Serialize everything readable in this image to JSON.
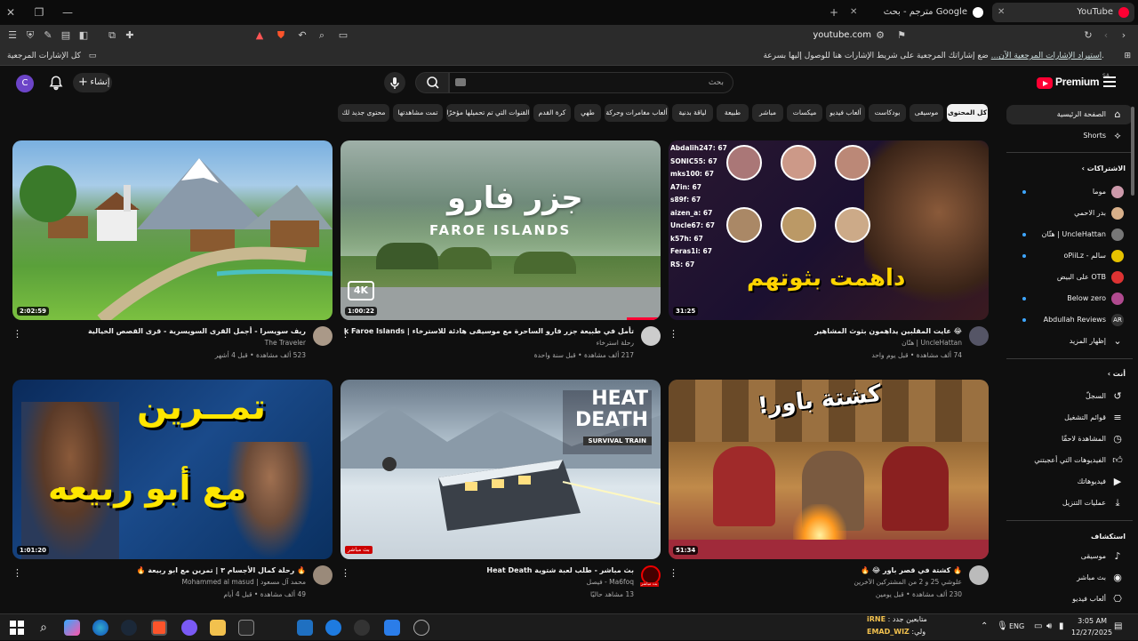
{
  "browser": {
    "tabs": [
      {
        "title": "YouTube",
        "active": true
      },
      {
        "title": "مترجم - بحث Google",
        "active": false
      }
    ],
    "url": "youtube.com",
    "bookmarks_folder": "كل الإشارات المرجعية",
    "bookmarks_hint": "ضع إشاراتك المرجعية على شريط الإشارات هنا للوصول إليها بسرعة.",
    "bookmarks_import": "استيراد الإشارات المرجعية الآن..."
  },
  "header": {
    "logo": "Premium",
    "logo_country": "SA",
    "search_placeholder": "بحث",
    "create_label": "إنشاء",
    "avatar_letter": "C"
  },
  "chips": [
    "كل المحتوى",
    "موسيقى",
    "بودكاست",
    "ألعاب فيديو",
    "ميكسات",
    "مباشر",
    "طبيعة",
    "لياقة بدنية",
    "ألعاب مغامرات وحركة",
    "طهي",
    "كرة القدم",
    "القنوات التي تم تحميلها مؤخرًا",
    "تمت مشاهدتها",
    "محتوى جديد لك"
  ],
  "sidebar": {
    "home": "الصفحة الرئيسية",
    "shorts": "Shorts",
    "subscriptions_title": "الاشتراكات",
    "subscriptions": [
      "موما",
      "بدر الاحمي",
      "UncleHattan | هتّان",
      "سالم - oPiiLz",
      "OTB على البيض",
      "Below zero",
      "Abdullah Reviews"
    ],
    "show_more": "إظهار المزيد",
    "you_title": "أنت",
    "you_items": [
      "السجلّ",
      "قوائم التشغيل",
      "المشاهدة لاحقًا",
      "الفيديوهات التي أعجبتني",
      "فيديوهاتك",
      "عمليات التنزيل"
    ],
    "explore_title": "استكشاف",
    "explore_items": [
      "موسيقى",
      "بث مباشر",
      "ألعاب فيديو"
    ]
  },
  "videos": [
    {
      "title": "😂 عايت المقلبين يداهمون بثوث المشاهير",
      "channel": "UncleHattan | هتّان",
      "meta": "74 ألف مشاهدة • قبل يوم واحد",
      "duration": "31:25",
      "thumb_text": "داهمت بثوتهم",
      "scores": [
        "Abdalih247: 67",
        "SONIC55: 67",
        "mks100: 67",
        "A7in: 67",
        "s89f: 67",
        "aizen_a: 67",
        "Uncle67: 67",
        "k57h: 67",
        "Feras1i: 67",
        "RS: 67"
      ]
    },
    {
      "title": "تأمل في طبيعة جزر فارو الساحرة  مع موسيقى هادئة للاسترخاء  | 4k Faroe Islands",
      "channel": "رحلة استرخاء",
      "meta": "217 ألف مشاهدة • قبل سنة واحدة",
      "duration": "1:00:22",
      "thumb_text": "جزر فارو",
      "thumb_sub": "FAROE ISLANDS",
      "badge": "4K"
    },
    {
      "title": "ريف سويسرا - أجمل القرى السويسرية - قرى القصص الخيالية",
      "channel": "The Traveler",
      "meta": "523 ألف مشاهدة • قبل 4 أشهر",
      "duration": "2:02:59"
    },
    {
      "title": "🔥 كشتة في قصر باور 😂 🔥",
      "channel": "علوشي 25 و 2 من المشتركين الآخرين",
      "meta": "230 ألف مشاهدة • قبل يومين",
      "duration": "51:34",
      "thumb_text": "كشتة باور!"
    },
    {
      "title": "بث مباشر - طلب لعبة شتوية Heat Death",
      "channel": "Ma6foq - فيصل",
      "meta": "13 مشاهد حاليًا",
      "live": "بث مباشر",
      "thumb_text": "HEAT DEATH",
      "thumb_sub": "SURVIVAL TRAIN",
      "avatar_live": "بث مباشر"
    },
    {
      "title": "🔥 رحلة كمال الأجسام ٣ | تمرين مع ابو ربيعة 🔥",
      "channel": "محمد آل مسعود | Mohammed al masud",
      "meta": "49 ألف مشاهدة • قبل 4 أيام",
      "duration": "1:01:20",
      "thumb_text": "تمــرين",
      "thumb_sub": "مع أبو ربيعه"
    }
  ],
  "taskbar": {
    "lang": "ENG",
    "time": "3:05 AM",
    "date": "12/27/2025",
    "notify1_label": "متابعين جدد :",
    "notify1_name": "iRNE",
    "notify2_label": "ولي:",
    "notify2_name": "EMAD_WIZ"
  },
  "colors": {
    "accent": "#ff0033",
    "bg": "#0f0f0f",
    "chip": "#272727",
    "link": "#3ea6ff"
  }
}
